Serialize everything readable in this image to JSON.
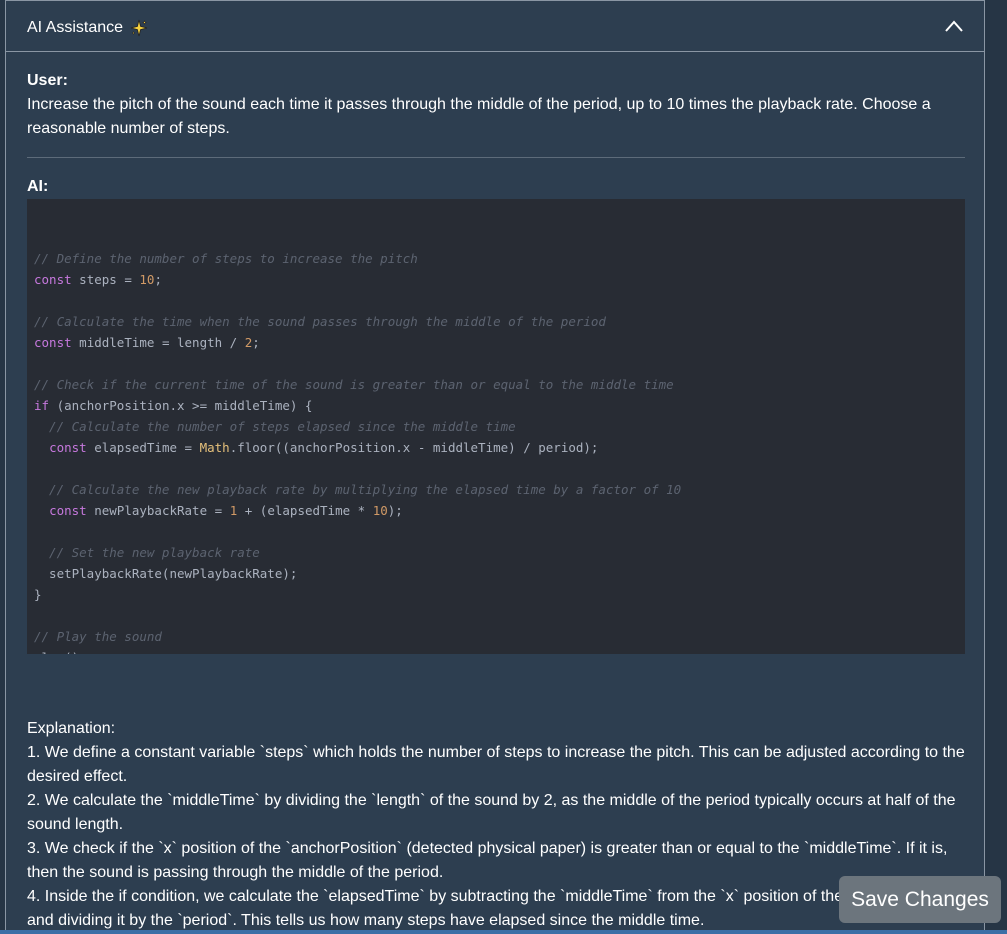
{
  "panel": {
    "title": "AI Assistance",
    "title_icon": "sparkle-icon",
    "toggle_icon": "chevron-up-icon"
  },
  "conversation": {
    "user_label": "User:",
    "user_message": "Increase the pitch of the sound each time it passes through the middle of the period, up to 10 times the playback rate. Choose a reasonable number of steps.",
    "ai_label": "AI:",
    "code_lines": [
      "",
      "// Define the number of steps to increase the pitch",
      "const steps = 10;",
      "",
      "// Calculate the time when the sound passes through the middle of the period",
      "const middleTime = length / 2;",
      "",
      "// Check if the current time of the sound is greater than or equal to the middle time",
      "if (anchorPosition.x >= middleTime) {",
      "  // Calculate the number of steps elapsed since the middle time",
      "  const elapsedTime = Math.floor((anchorPosition.x - middleTime) / period);",
      "",
      "  // Calculate the new playback rate by multiplying the elapsed time by a factor of 10",
      "  const newPlaybackRate = 1 + (elapsedTime * 10);",
      "",
      "  // Set the new playback rate",
      "  setPlaybackRate(newPlaybackRate);",
      "}",
      "",
      "// Play the sound",
      "play();"
    ],
    "explanation": [
      "Explanation:",
      "1. We define a constant variable `steps` which holds the number of steps to increase the pitch. This can be adjusted according to the desired effect.",
      "2. We calculate the `middleTime` by dividing the `length` of the sound by 2, as the middle of the period typically occurs at half of the sound length.",
      "3. We check if the `x` position of the `anchorPosition` (detected physical paper) is greater than or equal to the `middleTime`. If it is, then the sound is passing through the middle of the period.",
      "4. Inside the if condition, we calculate the `elapsedTime` by subtracting the `middleTime` from the `x` position of the `anchorPosition` and dividing it by the `period`. This tells us how many steps have elapsed since the middle time."
    ]
  },
  "actions": {
    "save_label": "Save Changes"
  },
  "colors": {
    "panel_bg": "#2d3e50",
    "code_bg": "#282c34",
    "comment": "#5c6370",
    "keyword": "#c678dd",
    "number": "#d19a66",
    "class": "#e5c07b",
    "button_bg": "#6c757d"
  }
}
